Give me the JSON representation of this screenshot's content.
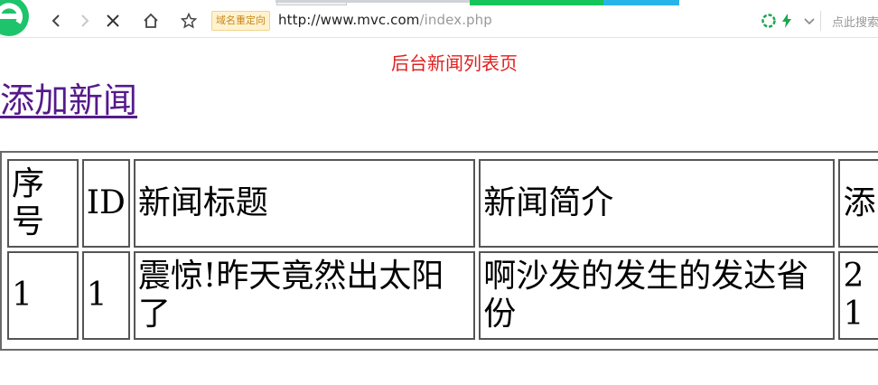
{
  "browser": {
    "url_host": "http://www.mvc.com",
    "url_path": "/index.php",
    "redirect_badge": "域名重定向",
    "search_hint": "点此搜索"
  },
  "page": {
    "title": "后台新闻列表页",
    "add_link": "添加新闻"
  },
  "table": {
    "headers": [
      "序号",
      "ID",
      "新闻标题",
      "新闻简介",
      "添"
    ],
    "rows": [
      [
        "1",
        "1",
        "震惊!昨天竟然出太阳了",
        "啊沙发的发生的发达省份",
        "2"
      ]
    ],
    "row_extra": "1"
  }
}
